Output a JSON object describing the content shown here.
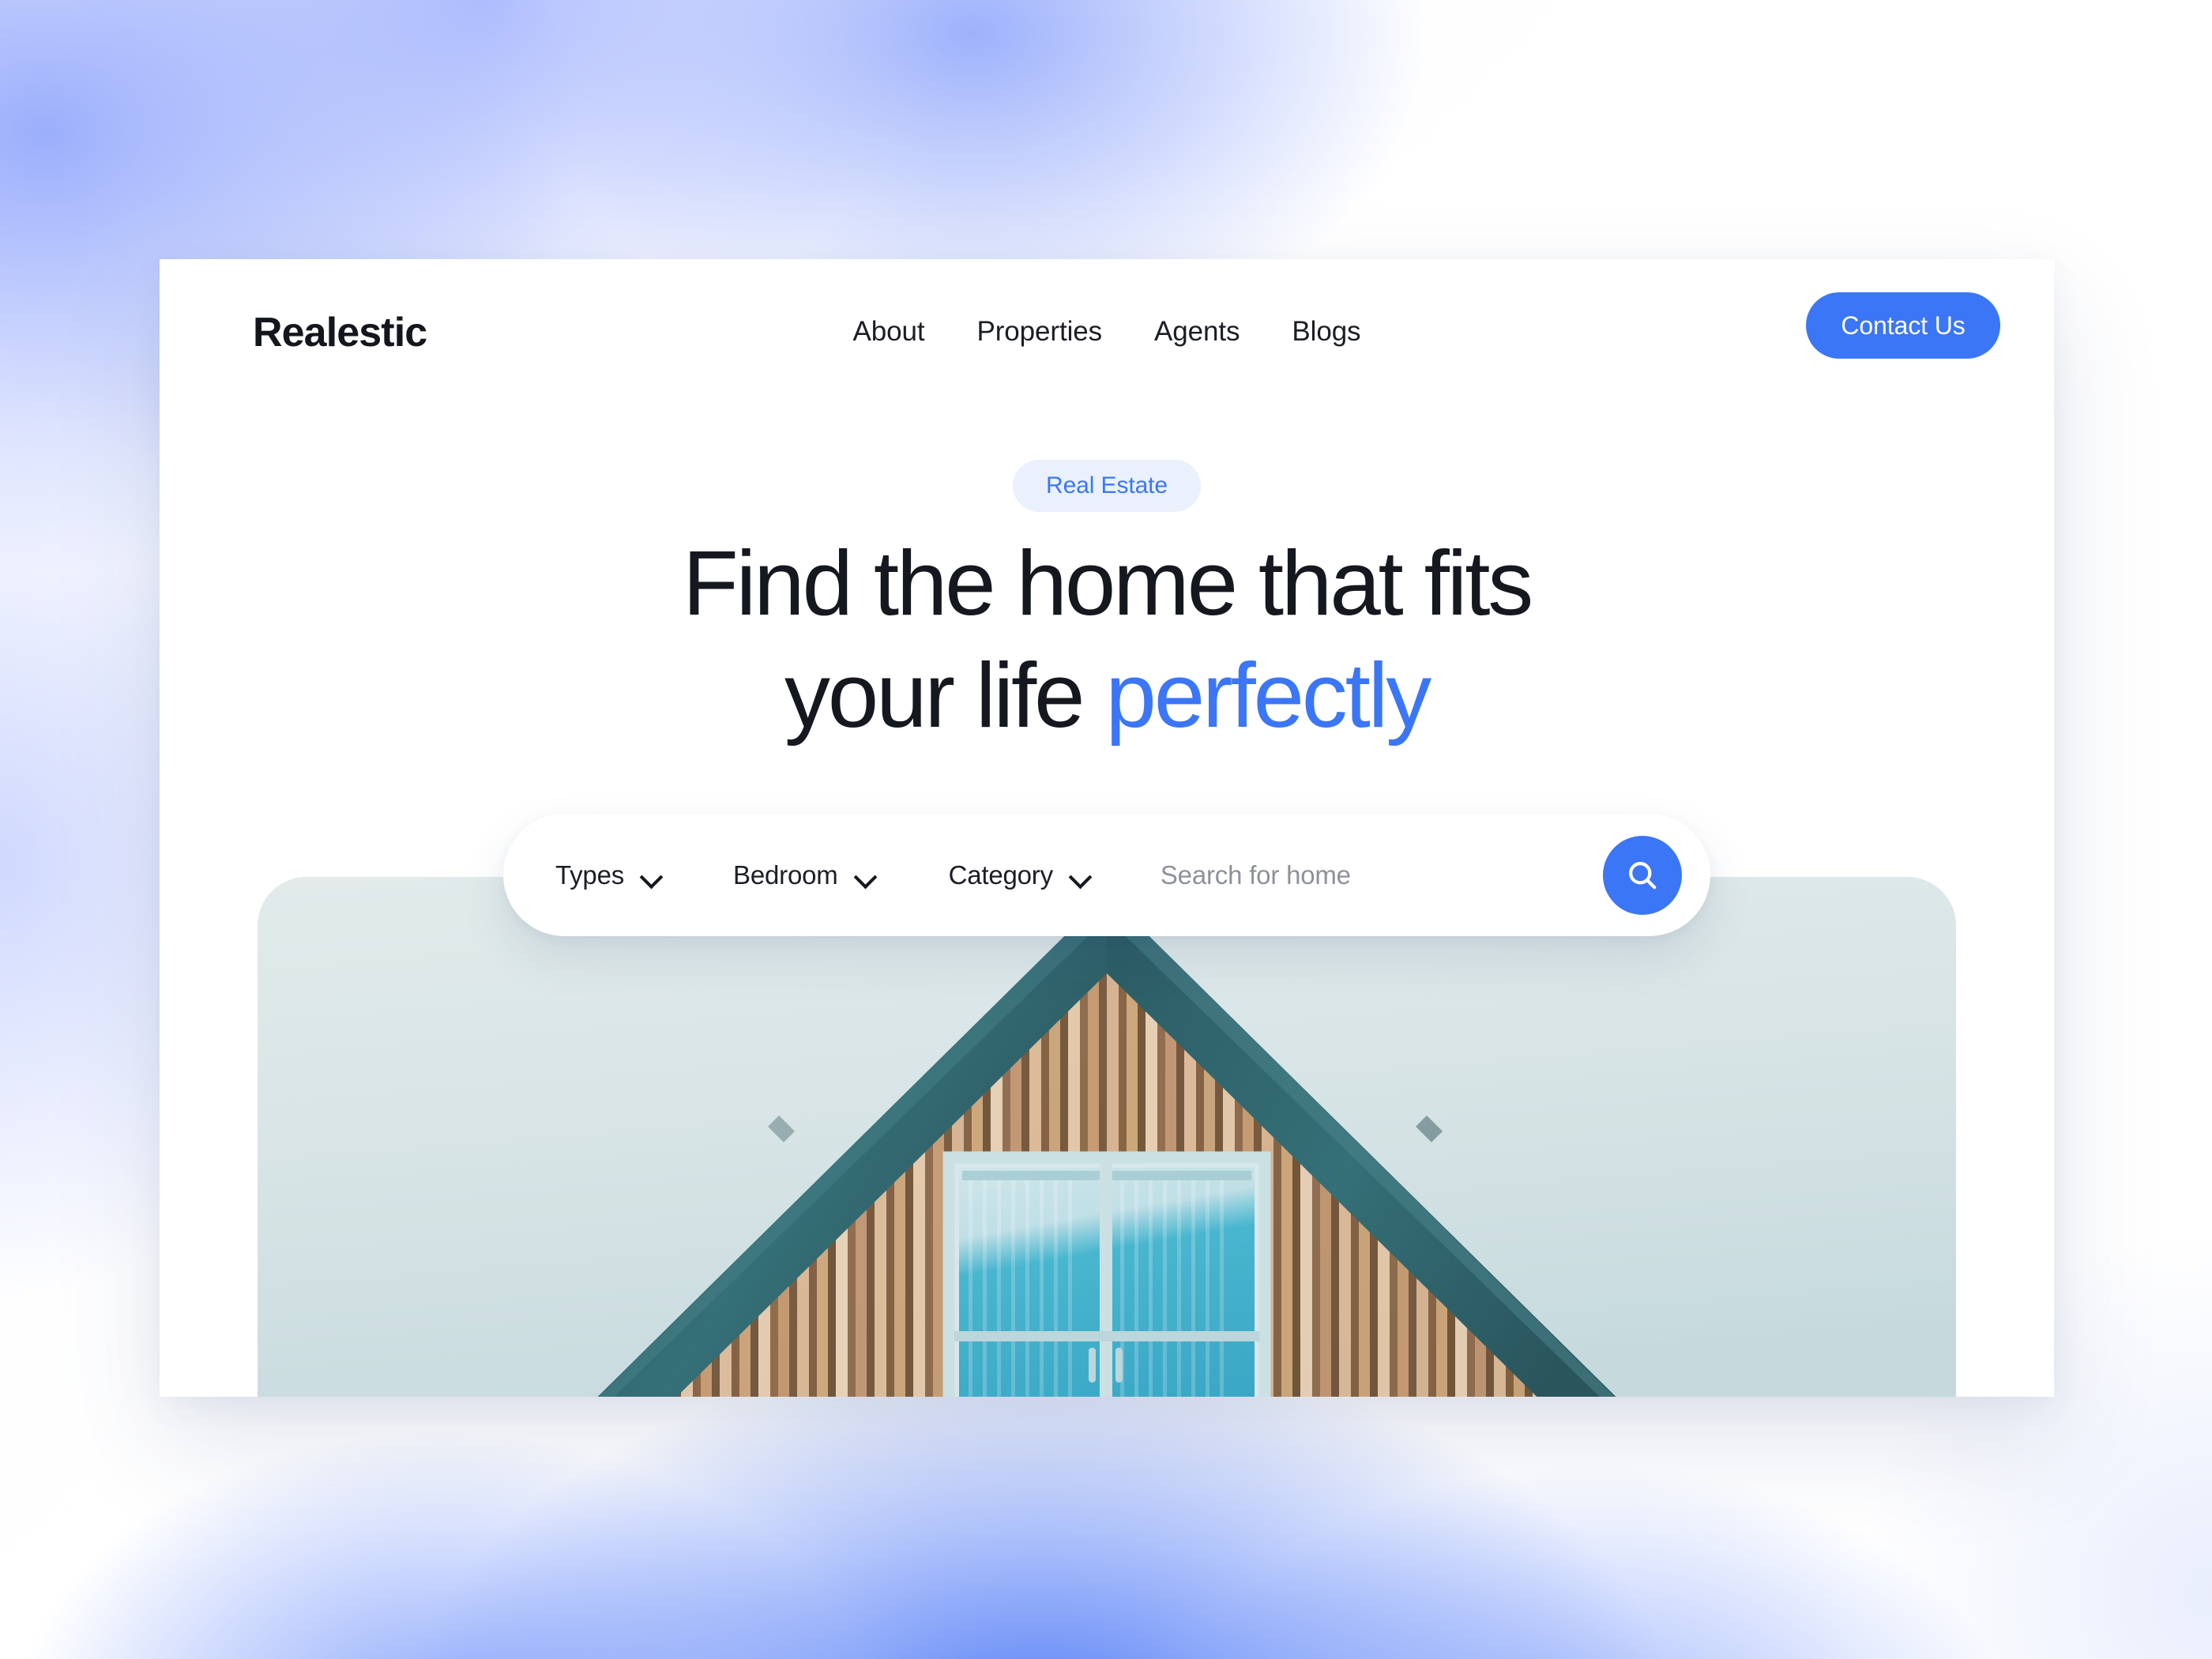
{
  "brand": {
    "name": "Realestic"
  },
  "nav": {
    "links": [
      {
        "label": "About"
      },
      {
        "label": "Properties"
      },
      {
        "label": "Agents"
      },
      {
        "label": "Blogs"
      }
    ],
    "cta": {
      "label": "Contact Us"
    }
  },
  "hero": {
    "badge": "Real Estate",
    "headline_line1": "Find the home that fits",
    "headline_line2_plain": "your life ",
    "headline_line2_accent": "perfectly"
  },
  "search": {
    "filters": [
      {
        "label": "Types",
        "icon": "chevron-down-icon"
      },
      {
        "label": "Bedroom",
        "icon": "chevron-down-icon"
      },
      {
        "label": "Category",
        "icon": "chevron-down-icon"
      }
    ],
    "input_value": "",
    "placeholder": "Search for home",
    "submit_icon": "search-icon"
  },
  "image": {
    "alt": "Wooden gable house with teal roof and blue curtained window against pale sky",
    "sky_color": "#d6e3e5",
    "roof_color": "#2e5f66",
    "wood_color": "#c08a55",
    "window_color": "#3fb3cd"
  },
  "colors": {
    "accent_blue": "#3b76f6",
    "badge_bg": "#eaf1fd",
    "text_dark": "#15181f",
    "placeholder_grey": "#8d9199",
    "card_white": "#ffffff",
    "backdrop_periwinkle": "#b6c3fa",
    "backdrop_blue": "#6a94f5"
  }
}
